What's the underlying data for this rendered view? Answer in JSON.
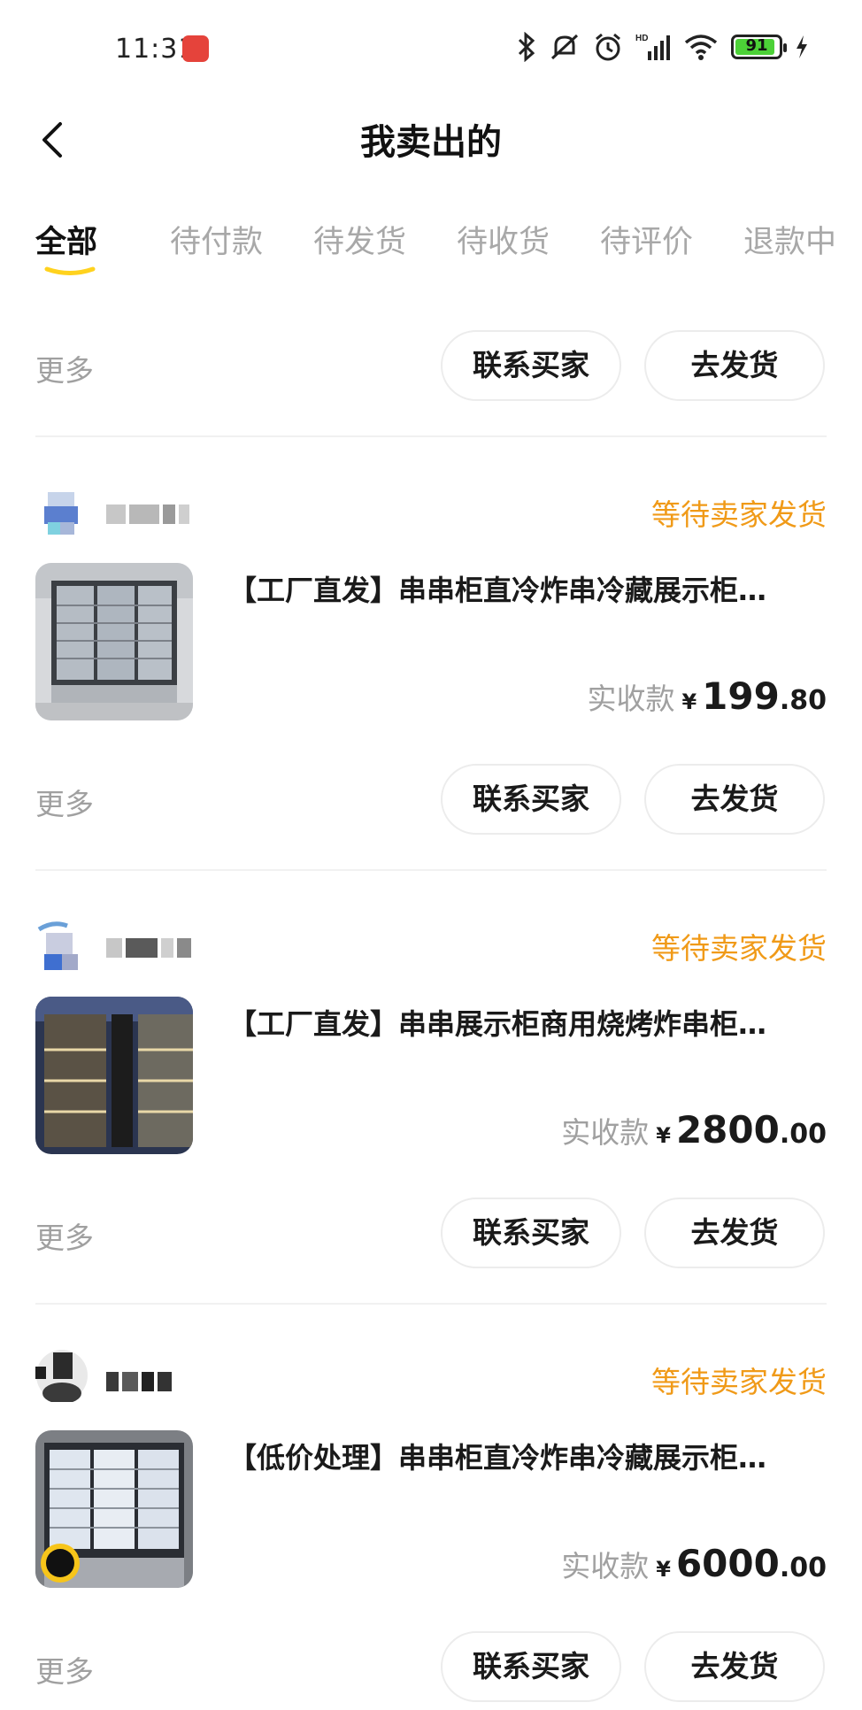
{
  "status_bar": {
    "time": "11:31",
    "battery": "91"
  },
  "header": {
    "title": "我卖出的"
  },
  "tabs": [
    {
      "label": "全部",
      "active": true
    },
    {
      "label": "待付款"
    },
    {
      "label": "待发货"
    },
    {
      "label": "待收货"
    },
    {
      "label": "待评价"
    },
    {
      "label": "退款中"
    }
  ],
  "more_label": "更多",
  "contact_label": "联系买家",
  "ship_label": "去发货",
  "price_label": "实收款",
  "currency": "¥",
  "orders": [
    {
      "status": "等待卖家发货",
      "title": "【工厂直发】串串柜直冷炸串冷藏展示柜…",
      "price_int": "199",
      "price_dec": ".80"
    },
    {
      "status": "等待卖家发货",
      "title": "【工厂直发】串串展示柜商用烧烤炸串柜…",
      "price_int": "2800",
      "price_dec": ".00"
    },
    {
      "status": "等待卖家发货",
      "title": "【低价处理】串串柜直冷炸串冷藏展示柜…",
      "price_int": "6000",
      "price_dec": ".00"
    }
  ],
  "colors": {
    "accent_status": "#f09a18",
    "tab_underline": "#ffd21e",
    "muted": "#a0a0a0"
  }
}
